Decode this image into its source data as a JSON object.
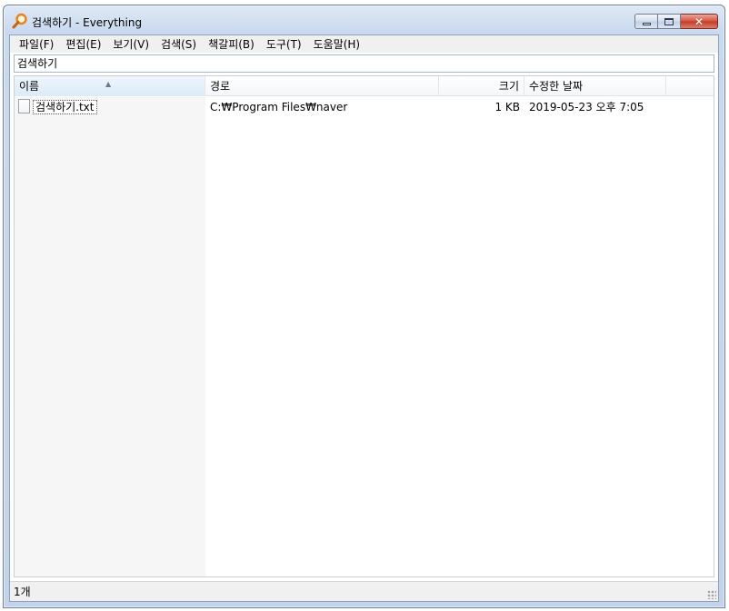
{
  "window": {
    "title": "검색하기 - Everything",
    "app_icon": "magnifier-icon",
    "accent_color": "#e8821c"
  },
  "menu": [
    "파일(F)",
    "편집(E)",
    "보기(V)",
    "검색(S)",
    "책갈피(B)",
    "도구(T)",
    "도움말(H)"
  ],
  "search": {
    "value": "검색하기"
  },
  "columns": {
    "name": "이름",
    "path": "경로",
    "size": "크기",
    "date": "수정한 날짜",
    "sorted_by": "name",
    "sort_direction": "ascending"
  },
  "rows": [
    {
      "name": "검색하기.txt",
      "path": "C:₩Program Files₩naver",
      "size": "1 KB",
      "date": "2019-05-23 오후 7:05",
      "icon": "text-file-icon"
    }
  ],
  "status": {
    "count": "1개"
  }
}
